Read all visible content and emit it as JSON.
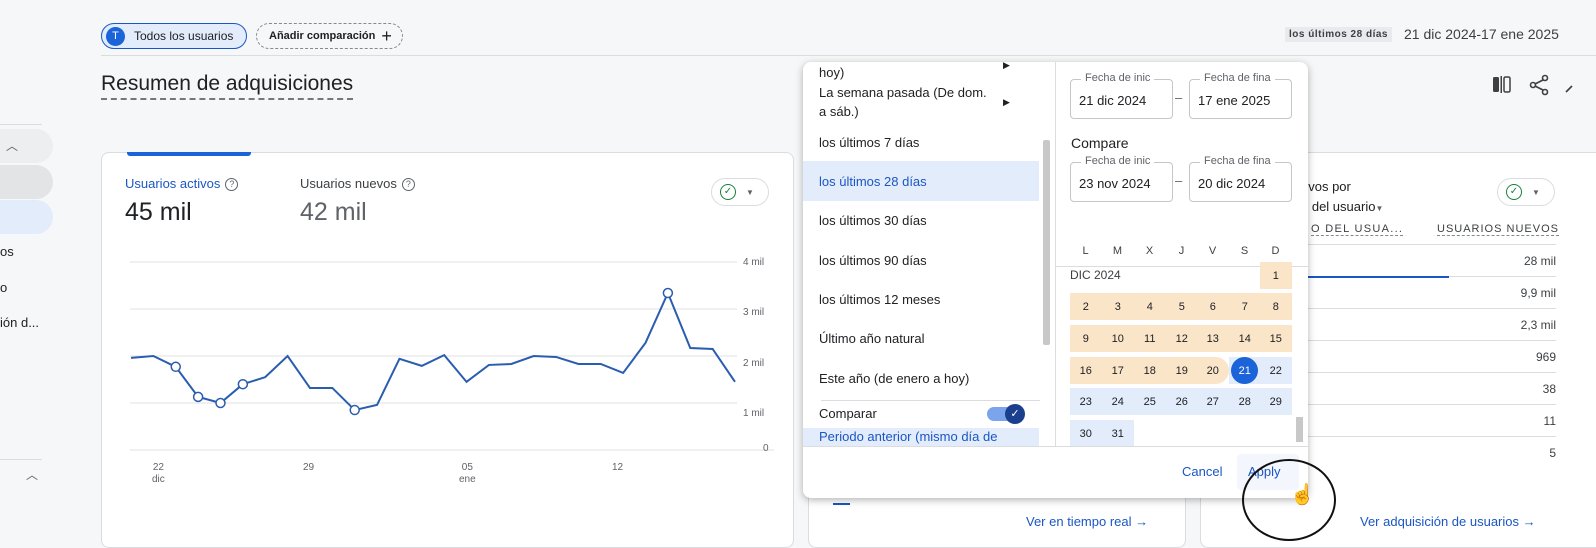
{
  "header": {
    "segment_avatar": "T",
    "segment": "Todos los usuarios",
    "add_comparison": "Añadir comparación",
    "plus": "+",
    "range_label": "los últimos 28 días",
    "range_dates": "21 dic 2024-17 ene 2025"
  },
  "page_title": "Resumen de adquisiciones",
  "sidebar": {
    "items": [
      "os",
      "o",
      "ión d..."
    ]
  },
  "card1": {
    "metric1_label": "Usuarios activos",
    "metric1_value": "45 mil",
    "metric2_label": "Usuarios nuevos",
    "metric2_value": "42 mil",
    "y_ticks": [
      "4 mil",
      "3 mil",
      "2 mil",
      "1 mil",
      "0"
    ],
    "x_ticks": [
      {
        "d": "22",
        "m": "dic"
      },
      {
        "d": "29",
        "m": ""
      },
      {
        "d": "05",
        "m": "ene"
      },
      {
        "d": "12",
        "m": ""
      }
    ]
  },
  "chart_data": {
    "type": "line",
    "title": "Usuarios activos",
    "xlabel": "",
    "ylabel": "",
    "ylim": [
      0,
      4000
    ],
    "x": [
      "21 dic",
      "22 dic",
      "23 dic",
      "24 dic",
      "25 dic",
      "26 dic",
      "27 dic",
      "28 dic",
      "29 dic",
      "30 dic",
      "31 dic",
      "01 ene",
      "02 ene",
      "03 ene",
      "04 ene",
      "05 ene",
      "06 ene",
      "07 ene",
      "08 ene",
      "09 ene",
      "10 ene",
      "11 ene",
      "12 ene",
      "13 ene",
      "14 ene",
      "15 ene",
      "16 ene",
      "17 ene"
    ],
    "values": [
      1960,
      2000,
      1770,
      1130,
      1000,
      1400,
      1550,
      2000,
      1320,
      1320,
      850,
      960,
      1940,
      1790,
      2020,
      1450,
      1810,
      1830,
      2000,
      1980,
      1830,
      1830,
      1640,
      2280,
      3340,
      2170,
      2150,
      1450
    ],
    "markers": [
      2,
      3,
      4,
      5,
      10,
      24
    ],
    "grid": true
  },
  "card2": {
    "link": "Ver en tiempo real"
  },
  "card3": {
    "title1": "evos por",
    "title2": "o del usuario",
    "col1": "O DEL USUA...",
    "col2": "USUARIOS NUEVOS",
    "values": [
      "28 mil",
      "9,9 mil",
      "2,3 mil",
      "969",
      "38",
      "11",
      "5"
    ],
    "bar_fraction": 0.62,
    "link": "Ver adquisición de usuarios"
  },
  "popup": {
    "options": [
      "hoy)",
      "La semana pasada (De dom. a sáb.)",
      "los últimos 7 días",
      "los últimos 28 días",
      "los últimos 30 días",
      "los últimos 90 días",
      "los últimos 12 meses",
      "Último año natural",
      "Este año (de enero a hoy)"
    ],
    "selected_option": "los últimos 28 días",
    "compare_label": "Comparar",
    "compare_on": true,
    "compare_period": "Periodo anterior (mismo día de",
    "start_label": "Fecha de inic",
    "end_label": "Fecha de fina",
    "start": "21 dic 2024",
    "end": "17 ene 2025",
    "compare_title": "Compare",
    "cmp_start": "23 nov 2024",
    "cmp_end": "20 dic 2024",
    "weekdays": [
      "L",
      "M",
      "X",
      "J",
      "V",
      "S",
      "D"
    ],
    "month": "DIC 2024",
    "cancel": "Cancel",
    "apply": "Apply"
  }
}
